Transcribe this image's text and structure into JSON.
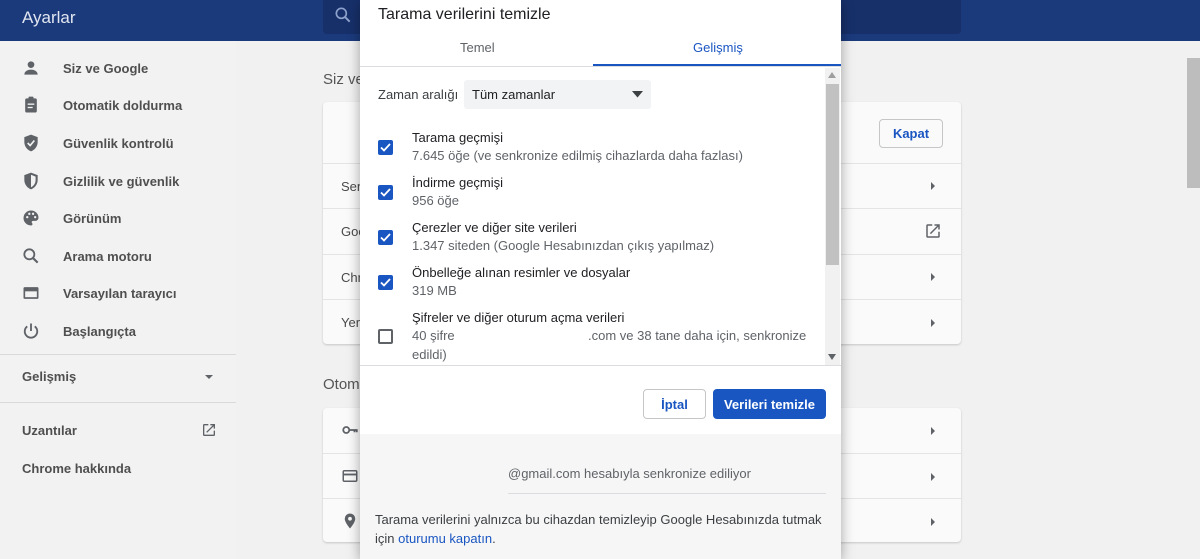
{
  "header": {
    "title": "Ayarlar",
    "search_icon": "search-icon"
  },
  "sidebar": {
    "items": [
      {
        "label": "Siz ve Google",
        "icon": "person-icon"
      },
      {
        "label": "Otomatik doldurma",
        "icon": "clipboard-icon"
      },
      {
        "label": "Güvenlik kontrolü",
        "icon": "shield-check-icon"
      },
      {
        "label": "Gizlilik ve güvenlik",
        "icon": "shield-icon"
      },
      {
        "label": "Görünüm",
        "icon": "palette-icon"
      },
      {
        "label": "Arama motoru",
        "icon": "search-icon"
      },
      {
        "label": "Varsayılan tarayıcı",
        "icon": "browser-icon"
      },
      {
        "label": "Başlangıçta",
        "icon": "power-icon"
      }
    ],
    "advanced": "Gelişmiş",
    "extensions": "Uzantılar",
    "about": "Chrome hakkında"
  },
  "main": {
    "section1_fragment": "Siz ve",
    "section2_fragment": "Otoma",
    "kapat_button": "Kapat",
    "row_fragments": [
      "Ser",
      "Goo",
      "Chr",
      "Yer"
    ]
  },
  "dialog": {
    "title": "Tarama verilerini temizle",
    "tabs": [
      "Temel",
      "Gelişmiş"
    ],
    "active_tab": "Gelişmiş",
    "time_range_label": "Zaman aralığı",
    "time_range_value": "Tüm zamanlar",
    "options": [
      {
        "title": "Tarama geçmişi",
        "subtitle": "7.645 öğe (ve senkronize edilmiş cihazlarda daha fazlası)",
        "checked": true
      },
      {
        "title": "İndirme geçmişi",
        "subtitle": "956 öğe",
        "checked": true
      },
      {
        "title": "Çerezler ve diğer site verileri",
        "subtitle": "1.347 siteden (Google Hesabınızdan çıkış yapılmaz)",
        "checked": true
      },
      {
        "title": "Önbelleğe alınan resimler ve dosyalar",
        "subtitle": "319 MB",
        "checked": true
      },
      {
        "title": "Şifreler ve diğer oturum açma verileri",
        "subtitle_a": "40 şifre",
        "subtitle_b": ".com ve 38 tane daha için, senkronize",
        "subtitle_c": "edildi)",
        "checked": false
      }
    ],
    "cancel_button": "İptal",
    "clear_button": "Verileri temizle",
    "sync_text": "@gmail.com hesabıyla senkronize ediliyor",
    "footer_note": "Tarama verilerini yalnızca bu cihazdan temizleyip Google Hesabınızda tutmak için ",
    "footer_link": "oturumu kapatın",
    "footer_end": "."
  },
  "colors": {
    "header": "#1b3a7c",
    "accent": "#1a56c2"
  }
}
